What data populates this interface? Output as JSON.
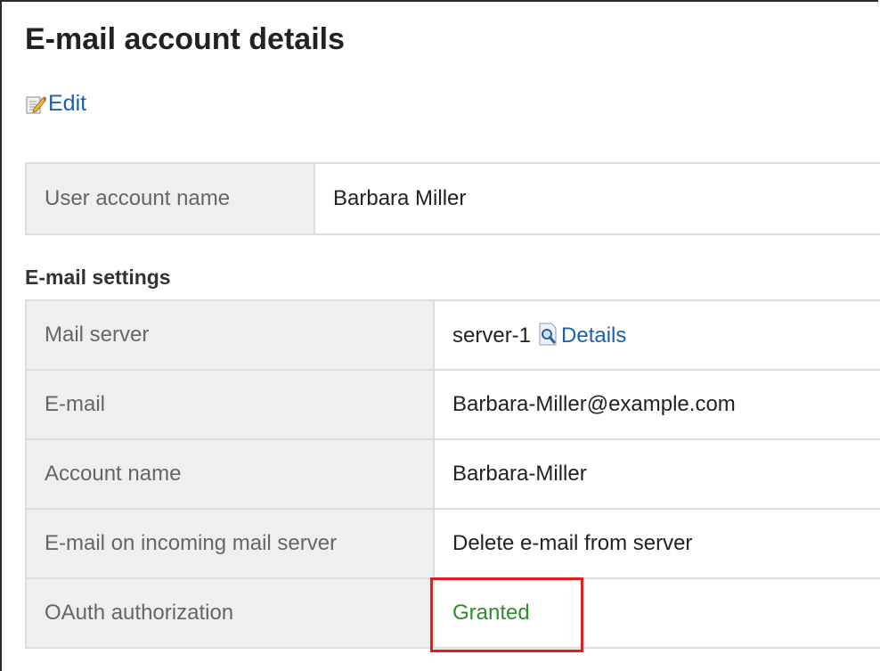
{
  "page": {
    "title": "E-mail account details"
  },
  "toolbar": {
    "edit_label": "Edit",
    "edit_icon": "edit-icon"
  },
  "user": {
    "label": "User account name",
    "value": "Barbara Miller"
  },
  "email_settings": {
    "section_label": "E-mail settings",
    "rows": {
      "mail_server": {
        "label": "Mail server",
        "value": "server-1",
        "details_label": "Details",
        "details_icon": "magnifier-icon"
      },
      "email": {
        "label": "E-mail",
        "value": "Barbara-Miller@example.com"
      },
      "account_name": {
        "label": "Account name",
        "value": "Barbara-Miller"
      },
      "incoming": {
        "label": "E-mail on incoming mail server",
        "value": "Delete e-mail from server"
      },
      "oauth": {
        "label": "OAuth authorization",
        "value": "Granted"
      }
    }
  },
  "colors": {
    "link": "#1a5fb4",
    "granted": "#2e8b2e",
    "highlight": "#e02020",
    "header_cell": "#efefef"
  }
}
